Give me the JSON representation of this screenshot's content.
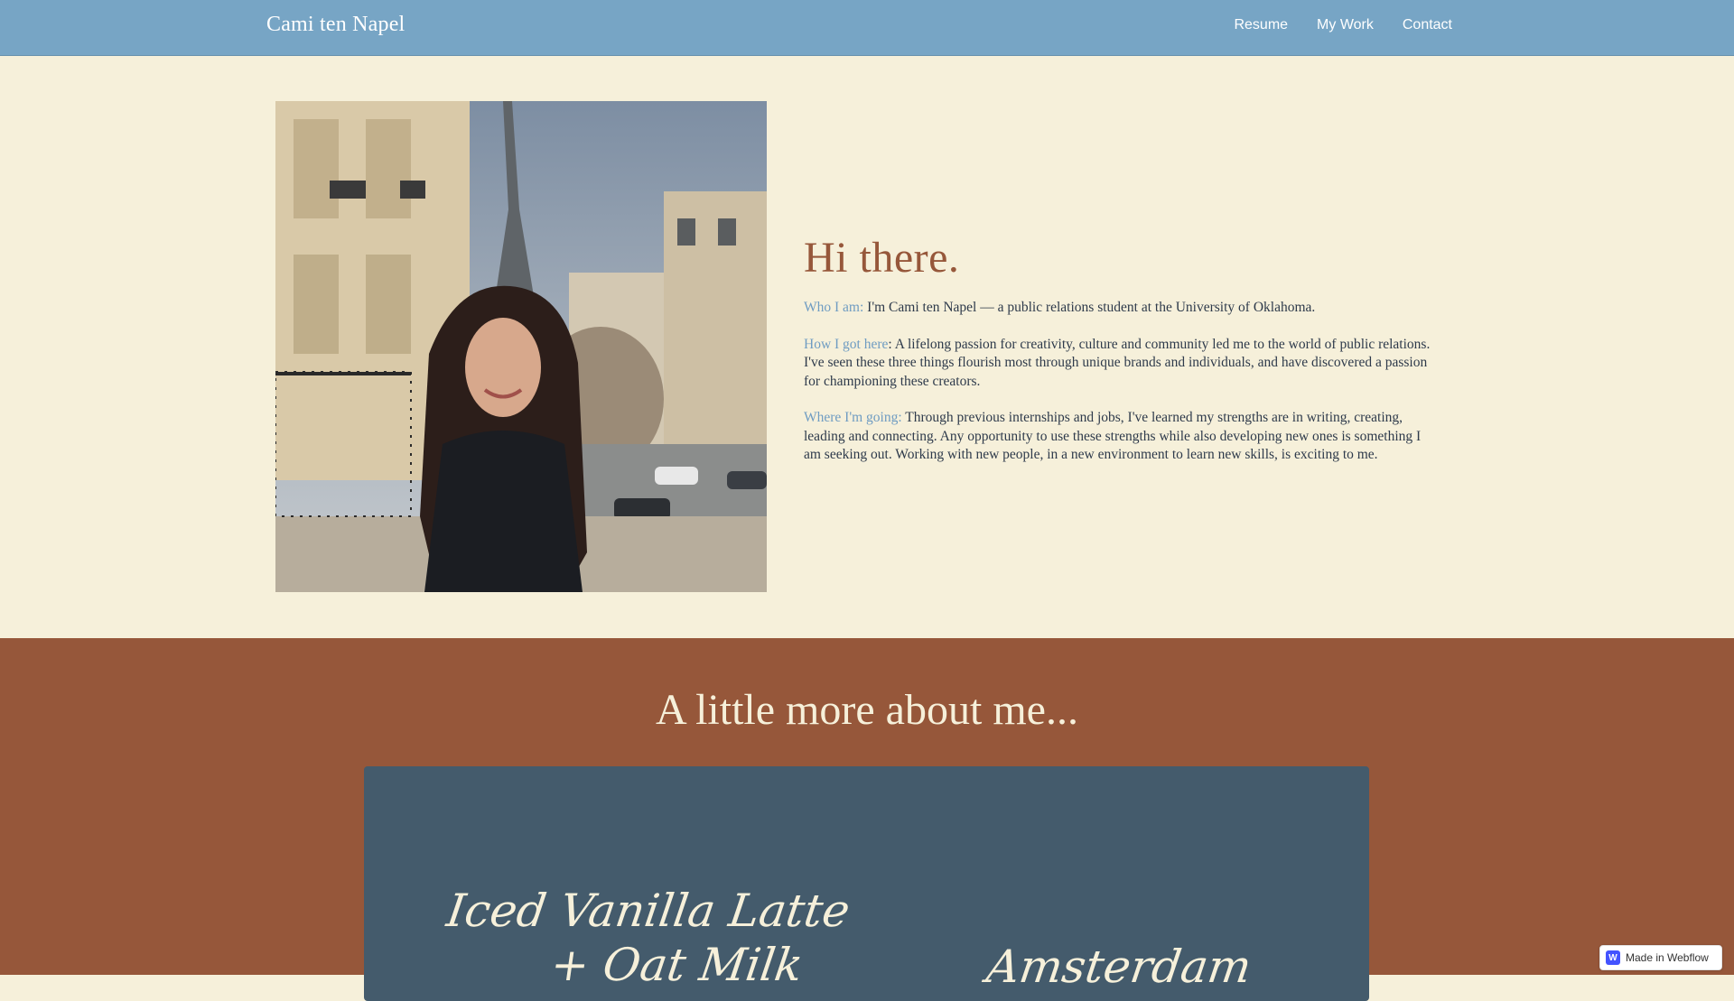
{
  "header": {
    "brand": "Cami ten Napel",
    "nav": [
      "Resume",
      "My Work",
      "Contact"
    ]
  },
  "hero": {
    "photo_icon": "portrait-photo",
    "heading": "Hi there.",
    "who_label": "Who I am:",
    "who_text": " I'm Cami ten Napel — a public relations student at the University of Oklahoma.",
    "how_label": "How I got here",
    "how_text": ": A lifelong passion for creativity, culture and community led me to the world of public relations. I've seen these three things flourish most through unique brands and individuals, and have discovered a passion for championing these creators.",
    "where_label": "Where I'm going:",
    "where_text": " Through previous internships and jobs, I've learned my strengths are in writing, creating, leading and connecting. Any opportunity to use these strengths while also developing new ones is something I am seeking out. Working with new people, in a new environment to learn new skills, is exciting to me."
  },
  "about": {
    "heading": "A little more about me...",
    "favorites": [
      {
        "line1": "Iced Vanilla Latte",
        "line2": "+ Oat Milk"
      },
      {
        "line1": "Amsterdam"
      }
    ]
  },
  "badge": {
    "icon": "W",
    "label": "Made in Webflow"
  },
  "colors": {
    "nav_bg": "#77a5c5",
    "cream": "#f6f0da",
    "rust": "#96573a",
    "slate": "#445b6c",
    "label_blue": "#6f9cc2"
  }
}
